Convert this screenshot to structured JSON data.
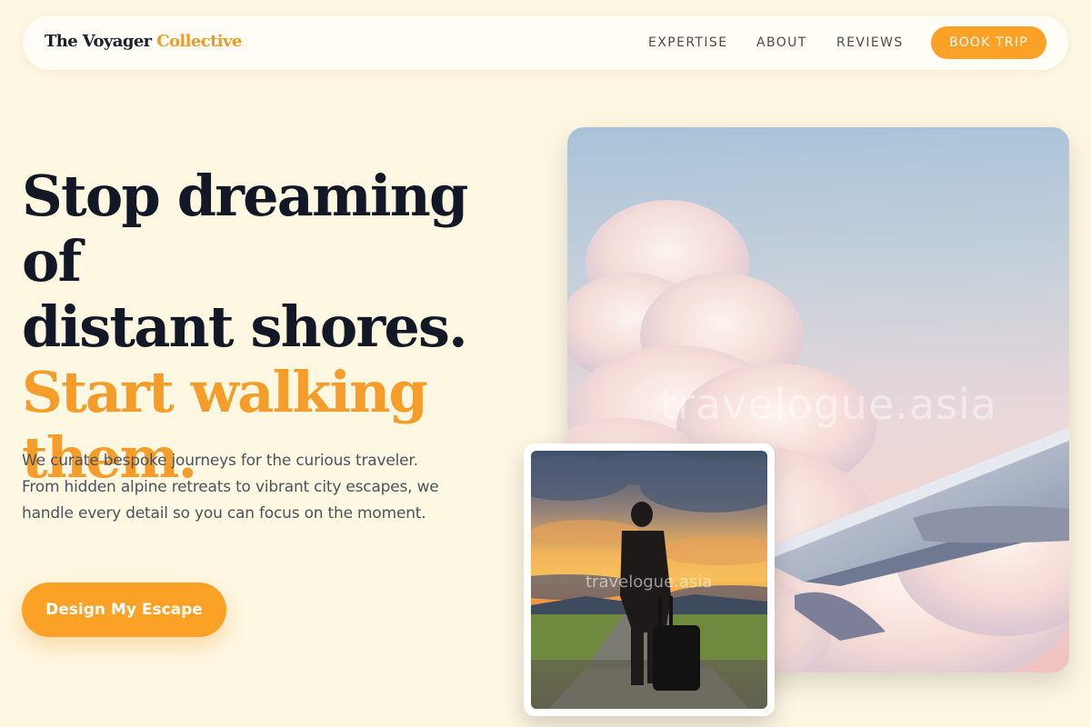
{
  "nav": {
    "logo_part1": "The Voyager",
    "logo_part2": "Collective",
    "links": [
      "EXPERTISE",
      "ABOUT",
      "REVIEWS"
    ],
    "book_button": "BOOK TRIP"
  },
  "hero": {
    "headline_line1": "Stop dreaming of",
    "headline_line2": "distant shores.",
    "headline_accent_line1": "Start walking",
    "headline_accent_line2": "them.",
    "subtext": "We curate bespoke journeys for the curious traveler. From hidden alpine retreats to vibrant city escapes, we handle every detail so you can focus on the moment.",
    "cta": "Design My Escape"
  },
  "images": {
    "sky_watermark": "travelogue.asia",
    "traveler_watermark": "travelogue.asia"
  },
  "colors": {
    "background": "#fef7e2",
    "accent": "#fba126",
    "headline": "#121826"
  }
}
